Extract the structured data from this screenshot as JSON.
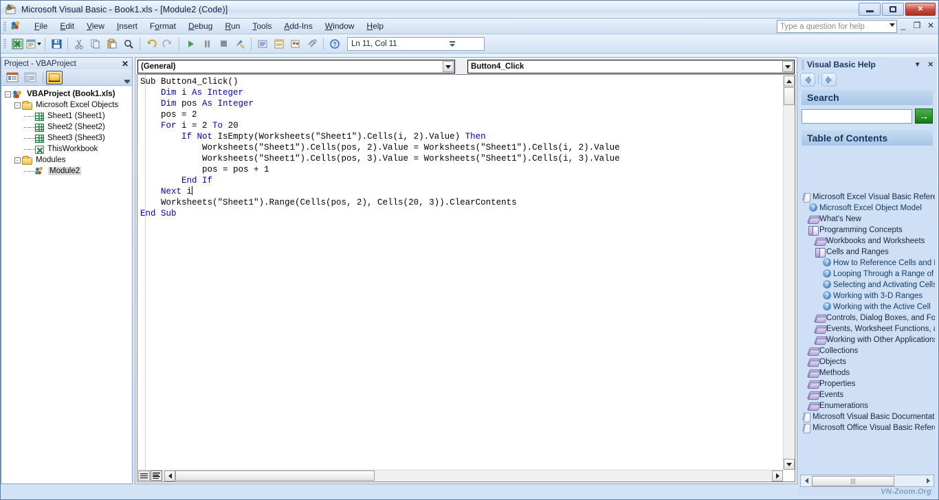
{
  "window": {
    "title": "Microsoft Visual Basic - Book1.xls - [Module2 (Code)]",
    "icon": "vb-app-icon",
    "minimize": "minimize-icon",
    "maximize": "maximize-icon",
    "close": "close-icon"
  },
  "menubar": {
    "items": [
      {
        "label": "File",
        "accel": "F"
      },
      {
        "label": "Edit",
        "accel": "E"
      },
      {
        "label": "View",
        "accel": "V"
      },
      {
        "label": "Insert",
        "accel": "I"
      },
      {
        "label": "Format",
        "accel": "o"
      },
      {
        "label": "Debug",
        "accel": "D"
      },
      {
        "label": "Run",
        "accel": "R"
      },
      {
        "label": "Tools",
        "accel": "T"
      },
      {
        "label": "Add-Ins",
        "accel": "A"
      },
      {
        "label": "Window",
        "accel": "W"
      },
      {
        "label": "Help",
        "accel": "H"
      }
    ],
    "help_question": {
      "placeholder": "Type a question for help",
      "value": ""
    },
    "mdi_restore": "restore-window-icon",
    "mdi_close": "close-document-icon"
  },
  "toolbar": {
    "buttons": [
      "view-excel-icon",
      "insert-module-icon",
      "save-icon",
      "cut-icon",
      "copy-icon",
      "paste-icon",
      "find-icon",
      "undo-icon",
      "redo-icon",
      "run-icon",
      "break-icon",
      "reset-icon",
      "design-mode-icon",
      "project-explorer-icon",
      "properties-window-icon",
      "object-browser-icon",
      "toolbox-icon",
      "help-icon"
    ],
    "position_indicator": "Ln 11, Col 11"
  },
  "project_explorer": {
    "title": "Project - VBAProject",
    "close_label": "✕",
    "toolbar_buttons": [
      "view-code-icon",
      "view-object-icon",
      "toggle-folders-icon"
    ],
    "tree": [
      {
        "label": "VBAProject (Book1.xls)",
        "icon": "vba-project-icon",
        "depth": 0,
        "toggle": "-",
        "bold": true,
        "selected": false
      },
      {
        "label": "Microsoft Excel Objects",
        "icon": "folder-icon",
        "depth": 1,
        "toggle": "-",
        "bold": false,
        "selected": false
      },
      {
        "label": "Sheet1 (Sheet1)",
        "icon": "excel-sheet-icon",
        "depth": 2,
        "toggle": "",
        "bold": false,
        "selected": false
      },
      {
        "label": "Sheet2 (Sheet2)",
        "icon": "excel-sheet-icon",
        "depth": 2,
        "toggle": "",
        "bold": false,
        "selected": false
      },
      {
        "label": "Sheet3 (Sheet3)",
        "icon": "excel-sheet-icon",
        "depth": 2,
        "toggle": "",
        "bold": false,
        "selected": false
      },
      {
        "label": "ThisWorkbook",
        "icon": "workbook-icon",
        "depth": 2,
        "toggle": "",
        "bold": false,
        "selected": false
      },
      {
        "label": "Modules",
        "icon": "folder-icon",
        "depth": 1,
        "toggle": "-",
        "bold": false,
        "selected": false
      },
      {
        "label": "Module2",
        "icon": "module-icon",
        "depth": 2,
        "toggle": "",
        "bold": false,
        "selected": true
      }
    ]
  },
  "code_window": {
    "object_combo": "(General)",
    "procedure_combo": "Button4_Click",
    "lines": [
      [
        {
          "t": "Sub Button4_Click()",
          "k": false
        }
      ],
      [
        {
          "t": "    ",
          "k": false
        },
        {
          "t": "Dim",
          "k": true
        },
        {
          "t": " i ",
          "k": false
        },
        {
          "t": "As Integer",
          "k": true
        }
      ],
      [
        {
          "t": "    ",
          "k": false
        },
        {
          "t": "Dim",
          "k": true
        },
        {
          "t": " pos ",
          "k": false
        },
        {
          "t": "As Integer",
          "k": true
        }
      ],
      [
        {
          "t": "    pos = 2",
          "k": false
        }
      ],
      [
        {
          "t": "    ",
          "k": false
        },
        {
          "t": "For",
          "k": true
        },
        {
          "t": " i = 2 ",
          "k": false
        },
        {
          "t": "To",
          "k": true
        },
        {
          "t": " 20",
          "k": false
        }
      ],
      [
        {
          "t": "        ",
          "k": false
        },
        {
          "t": "If Not",
          "k": true
        },
        {
          "t": " IsEmpty(Worksheets(\"Sheet1\").Cells(i, 2).Value) ",
          "k": false
        },
        {
          "t": "Then",
          "k": true
        }
      ],
      [
        {
          "t": "            Worksheets(\"Sheet1\").Cells(pos, 2).Value = Worksheets(\"Sheet1\").Cells(i, 2).Value",
          "k": false
        }
      ],
      [
        {
          "t": "            Worksheets(\"Sheet1\").Cells(pos, 3).Value = Worksheets(\"Sheet1\").Cells(i, 3).Value",
          "k": false
        }
      ],
      [
        {
          "t": "            pos = pos + 1",
          "k": false
        }
      ],
      [
        {
          "t": "        ",
          "k": false
        },
        {
          "t": "End If",
          "k": true
        }
      ],
      [
        {
          "t": "    ",
          "k": false
        },
        {
          "t": "Next",
          "k": true
        },
        {
          "t": " i",
          "k": false
        },
        {
          "t": "|CARET|",
          "k": false
        }
      ],
      [
        {
          "t": "    Worksheets(\"Sheet1\").Range(Cells(pos, 2), Cells(20, 3)).ClearContents",
          "k": false
        }
      ],
      [
        {
          "t": "",
          "k": false
        },
        {
          "t": "End Sub",
          "k": true
        }
      ]
    ],
    "view_buttons": [
      "procedure-view-icon",
      "full-module-view-icon"
    ]
  },
  "help_pane": {
    "title": "Visual Basic Help",
    "dropdown_icon": "chevron-down-icon",
    "close_icon": "close-icon",
    "nav": [
      "back-icon",
      "forward-icon"
    ],
    "search": {
      "heading": "Search",
      "value": "",
      "go_label": "→"
    },
    "toc": {
      "heading": "Table of Contents",
      "items": [
        {
          "label": "Microsoft Excel Visual Basic Reference",
          "icon": "page-icon",
          "depth": 0,
          "link": false
        },
        {
          "label": "Microsoft Excel Object Model",
          "icon": "topic-icon",
          "depth": 1,
          "link": true
        },
        {
          "label": "What's New",
          "icon": "book-closed-icon",
          "depth": 1,
          "link": false
        },
        {
          "label": "Programming Concepts",
          "icon": "book-open-icon",
          "depth": 1,
          "link": false
        },
        {
          "label": "Workbooks and Worksheets",
          "icon": "book-closed-icon",
          "depth": 2,
          "link": false
        },
        {
          "label": "Cells and Ranges",
          "icon": "book-open-icon",
          "depth": 2,
          "link": false
        },
        {
          "label": "How to Reference Cells and R",
          "icon": "topic-icon",
          "depth": 3,
          "link": true
        },
        {
          "label": "Looping Through a Range of ",
          "icon": "topic-icon",
          "depth": 3,
          "link": true
        },
        {
          "label": "Selecting and Activating Cells",
          "icon": "topic-icon",
          "depth": 3,
          "link": true
        },
        {
          "label": "Working with 3-D Ranges",
          "icon": "topic-icon",
          "depth": 3,
          "link": true
        },
        {
          "label": "Working with the Active Cell",
          "icon": "topic-icon",
          "depth": 3,
          "link": true
        },
        {
          "label": "Controls, Dialog Boxes, and Forn",
          "icon": "book-closed-icon",
          "depth": 2,
          "link": false
        },
        {
          "label": "Events, Worksheet Functions, a",
          "icon": "book-closed-icon",
          "depth": 2,
          "link": false
        },
        {
          "label": "Working with Other Applications",
          "icon": "book-closed-icon",
          "depth": 2,
          "link": false
        },
        {
          "label": "Collections",
          "icon": "book-closed-icon",
          "depth": 1,
          "link": false
        },
        {
          "label": "Objects",
          "icon": "book-closed-icon",
          "depth": 1,
          "link": false
        },
        {
          "label": "Methods",
          "icon": "book-closed-icon",
          "depth": 1,
          "link": false
        },
        {
          "label": "Properties",
          "icon": "book-closed-icon",
          "depth": 1,
          "link": false
        },
        {
          "label": "Events",
          "icon": "book-closed-icon",
          "depth": 1,
          "link": false
        },
        {
          "label": "Enumerations",
          "icon": "book-closed-icon",
          "depth": 1,
          "link": false
        },
        {
          "label": "Microsoft Visual Basic Documentation",
          "icon": "page-icon",
          "depth": 0,
          "link": false
        },
        {
          "label": "Microsoft Office Visual Basic Reference",
          "icon": "page-icon",
          "depth": 0,
          "link": false
        }
      ]
    },
    "watermark": "VN-Zoom.Org"
  },
  "colors": {
    "keyword": "#0000c0",
    "accent": "#16365c",
    "chrome": "#cfe0f3",
    "link": "#123a6b"
  }
}
